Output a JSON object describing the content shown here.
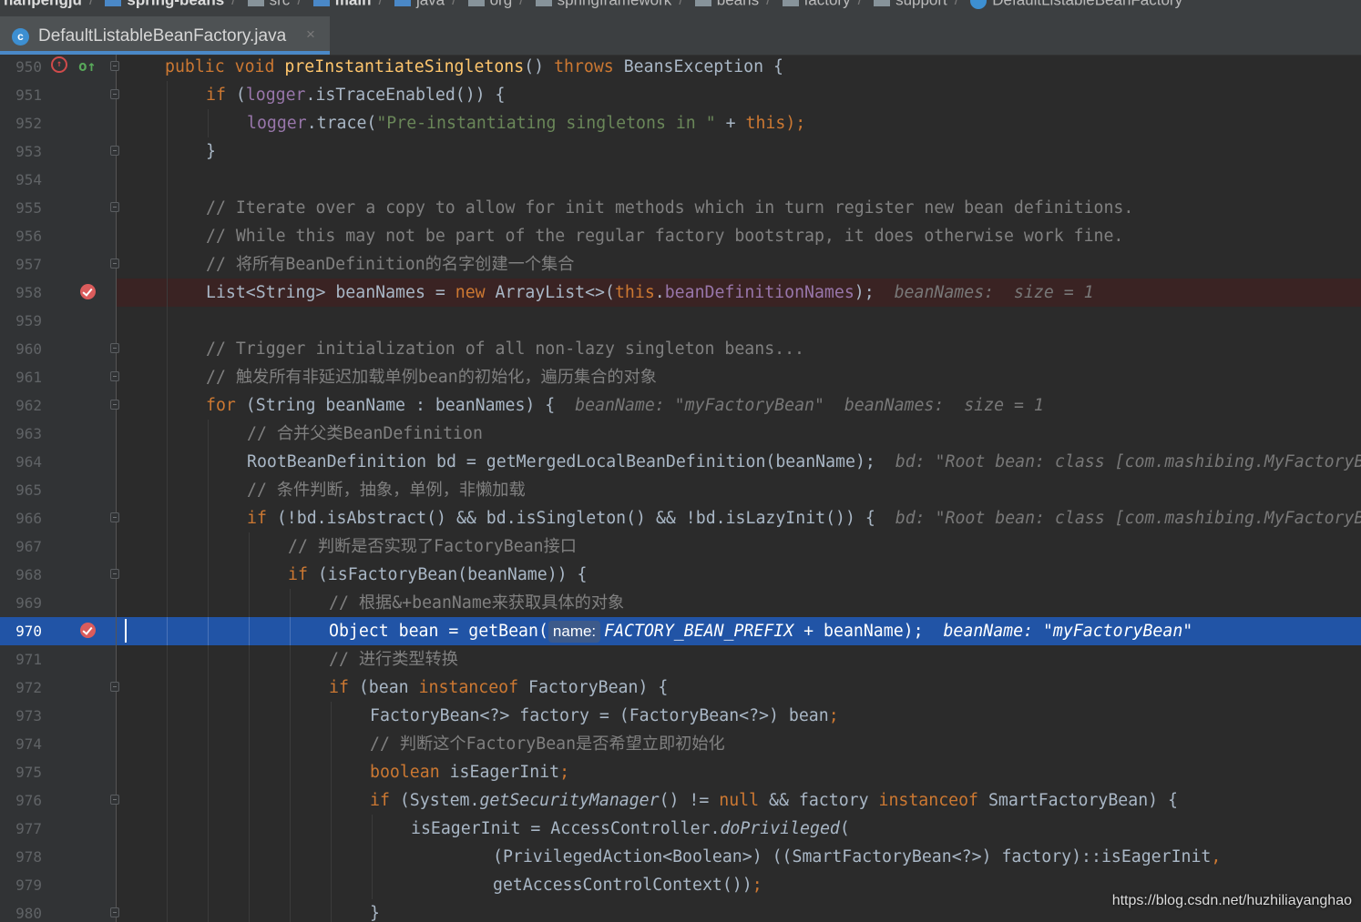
{
  "breadcrumbs": [
    "hanpengju",
    "spring-beans",
    "src",
    "main",
    "java",
    "org",
    "springframework",
    "beans",
    "factory",
    "support",
    "DefaultListableBeanFactory"
  ],
  "tab": {
    "label": "DefaultListableBeanFactory.java",
    "icon_letter": "c",
    "close": "×"
  },
  "watermark": "https://blog.csdn.net/huzhiliayanghao",
  "line_numbers": [
    "950",
    "951",
    "952",
    "953",
    "954",
    "955",
    "956",
    "957",
    "958",
    "959",
    "960",
    "961",
    "962",
    "963",
    "964",
    "965",
    "966",
    "967",
    "968",
    "969",
    "970",
    "971",
    "972",
    "973",
    "974",
    "975",
    "976",
    "977",
    "978",
    "979",
    "980"
  ],
  "code": {
    "l950": {
      "kw1": "public void ",
      "fn": "preInstantiateSingletons",
      "p1": "() ",
      "kw2": "throws",
      "p2": " BeansException {"
    },
    "l951": {
      "kw1": "if",
      "p1": " (",
      "fld": "logger",
      "p2": ".isTraceEnabled()) {"
    },
    "l952": {
      "fld": "logger",
      "p1": ".trace(",
      "str": "\"Pre-instantiating singletons in \"",
      "p2": " + ",
      "kw1": "this",
      "p3": ");"
    },
    "l953": {
      "p1": "}"
    },
    "l955": {
      "cm": "// Iterate over a copy to allow for init methods which in turn register new bean definitions."
    },
    "l956": {
      "cm": "// While this may not be part of the regular factory bootstrap, it does otherwise work fine."
    },
    "l957": {
      "cm": "// 将所有BeanDefinition的名字创建一个集合"
    },
    "l958": {
      "p1": "List<String> beanNames = ",
      "kw1": "new",
      "p2": " ArrayList<>(",
      "kw2": "this",
      "p3": ".",
      "fld": "beanDefinitionNames",
      "p4": ");",
      "inlay": "beanNames:  size = 1"
    },
    "l960": {
      "cm": "// Trigger initialization of all non-lazy singleton beans..."
    },
    "l961": {
      "cm": "// 触发所有非延迟加载单例bean的初始化，遍历集合的对象"
    },
    "l962": {
      "kw1": "for",
      "p1": " (String beanName : beanNames) {",
      "inlay": "beanName: \"myFactoryBean\"  beanNames:  size = 1"
    },
    "l963": {
      "cm": "// 合并父类BeanDefinition"
    },
    "l964": {
      "p1": "RootBeanDefinition bd = getMergedLocalBeanDefinition(beanName);",
      "inlay": "bd: \"Root bean: class [com.mashibing.MyFactoryBean]"
    },
    "l965": {
      "cm": "// 条件判断，抽象，单例，非懒加载"
    },
    "l966": {
      "kw1": "if",
      "p1": " (!bd.isAbstract() && bd.isSingleton() && !bd.isLazyInit()) {",
      "inlay": "bd: \"Root bean: class [com.mashibing.MyFactoryBean]"
    },
    "l967": {
      "cm": "// 判断是否实现了FactoryBean接口"
    },
    "l968": {
      "kw1": "if",
      "p1": " (isFactoryBean(beanName)) {"
    },
    "l969": {
      "cm": "// 根据&+beanName来获取具体的对象"
    },
    "l970": {
      "p1": "Object bean = getBean(",
      "hint": "name:",
      "fld": "FACTORY_BEAN_PREFIX",
      "p2": " + beanName)",
      "semi": ";",
      "inlay": "beanName: \"myFactoryBean\""
    },
    "l971": {
      "cm": "// 进行类型转换"
    },
    "l972": {
      "kw1": "if",
      "p1": " (bean ",
      "kw2": "instanceof",
      "p2": " FactoryBean) {"
    },
    "l973": {
      "p1": "FactoryBean<?> factory = (FactoryBean<?>) bean",
      "semi": ";"
    },
    "l974": {
      "cm": "// 判断这个FactoryBean是否希望立即初始化"
    },
    "l975": {
      "kw1": "boolean",
      "p1": " isEagerInit",
      "semi": ";"
    },
    "l976": {
      "kw1": "if",
      "p1": " (System.",
      "it": "getSecurityManager",
      "p2": "() != ",
      "kw2": "null",
      "p3": " && factory ",
      "kw3": "instanceof",
      "p4": " SmartFactoryBean) {"
    },
    "l977": {
      "p1": "isEagerInit = AccessController.",
      "it": "doPrivileged",
      "p2": "("
    },
    "l978": {
      "p1": "(PrivilegedAction<Boolean>) ((SmartFactoryBean<?>) factory)::isEagerInit",
      "semi": ","
    },
    "l979": {
      "p1": "getAccessControlContext())",
      "semi": ";"
    },
    "l980": {
      "p1": "}"
    }
  },
  "colors": {
    "background": "#2b2b2b",
    "gutter": "#313335",
    "keyword": "#cc7832",
    "string": "#6a8759",
    "comment": "#808080",
    "field": "#9876aa",
    "method": "#ffc66d",
    "execution_line": "#2154a6",
    "breakpoint": "#db5c5c"
  }
}
